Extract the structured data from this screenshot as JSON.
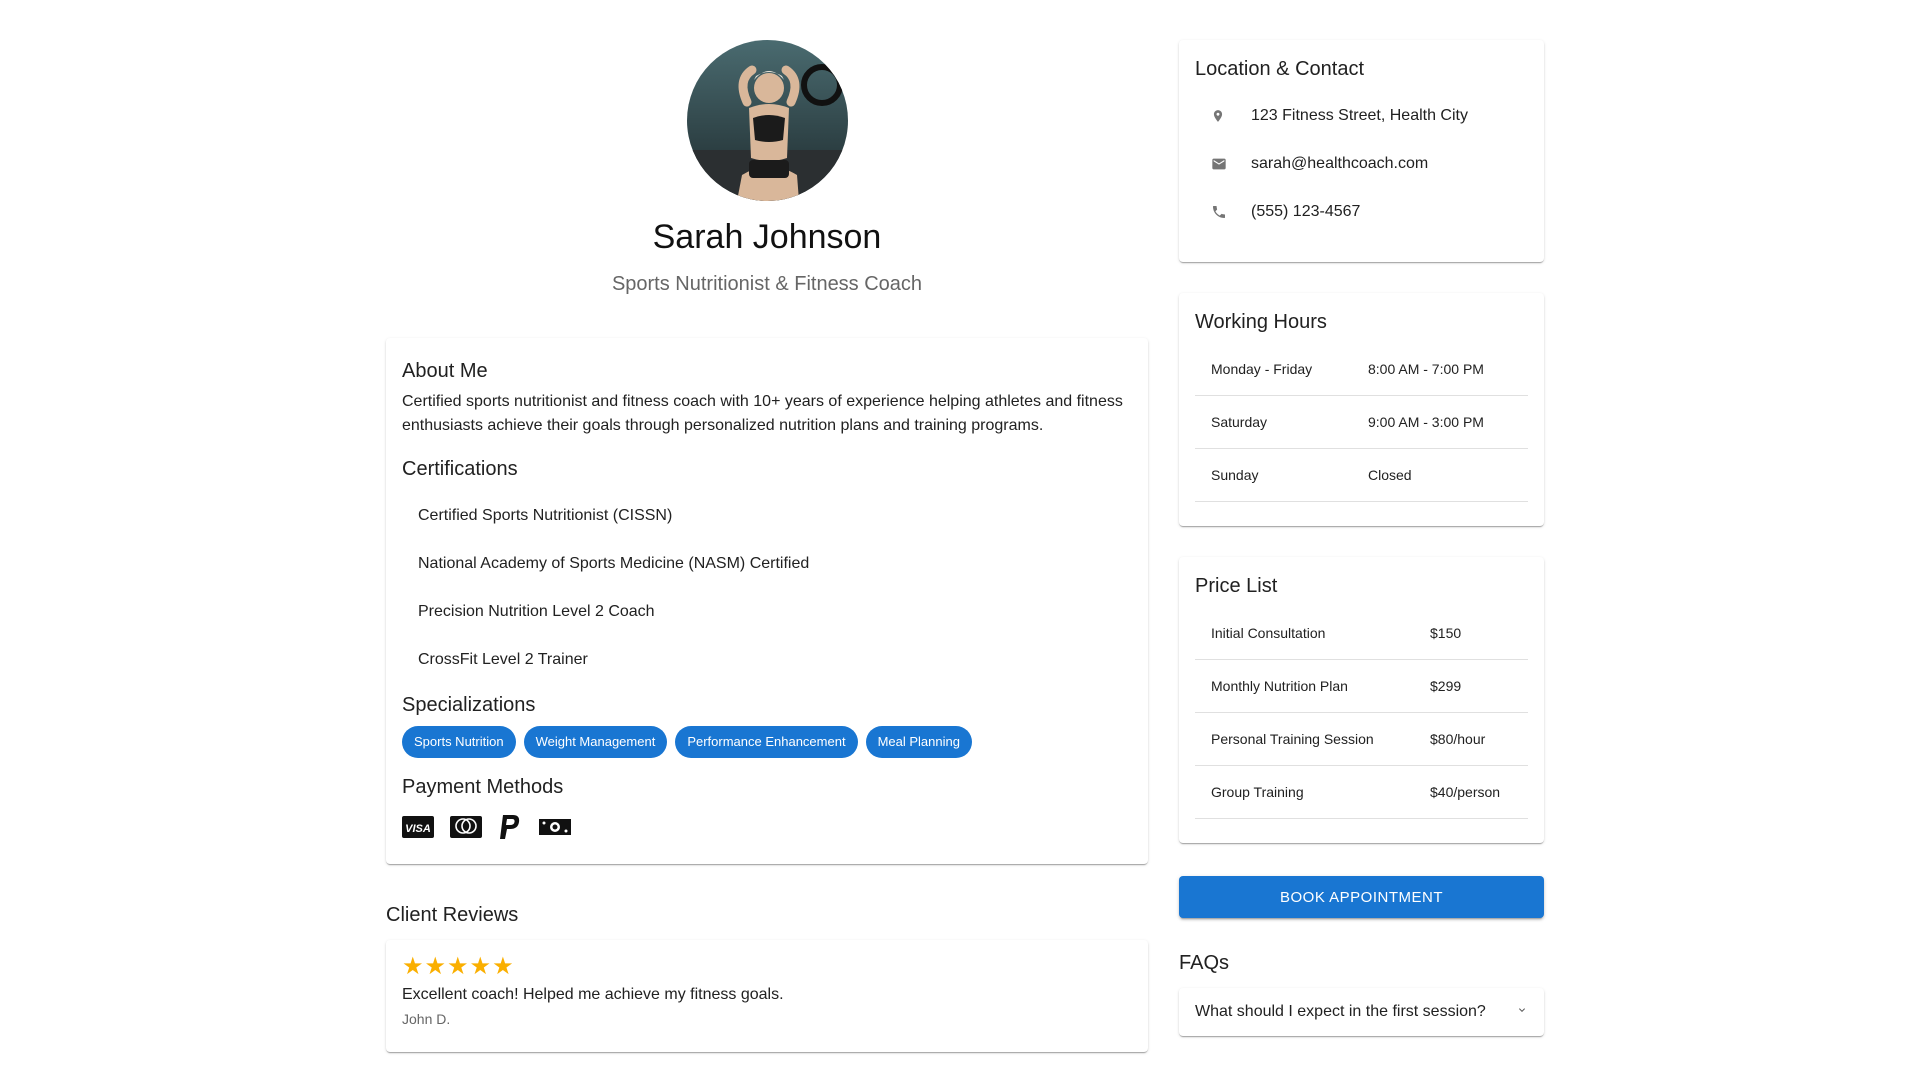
{
  "profile": {
    "name": "Sarah Johnson",
    "title": "Sports Nutritionist & Fitness Coach"
  },
  "about": {
    "heading": "About Me",
    "text": "Certified sports nutritionist and fitness coach with 10+ years of experience helping athletes and fitness enthusiasts achieve their goals through personalized nutrition plans and training programs."
  },
  "certifications": {
    "heading": "Certifications",
    "items": [
      "Certified Sports Nutritionist (CISSN)",
      "National Academy of Sports Medicine (NASM) Certified",
      "Precision Nutrition Level 2 Coach",
      "CrossFit Level 2 Trainer"
    ]
  },
  "specializations": {
    "heading": "Specializations",
    "chips": [
      "Sports Nutrition",
      "Weight Management",
      "Performance Enhancement",
      "Meal Planning"
    ]
  },
  "payment": {
    "heading": "Payment Methods",
    "icons": [
      "visa-icon",
      "mastercard-icon",
      "paypal-icon",
      "cash-icon"
    ],
    "visa_text": "VISA"
  },
  "reviews": {
    "heading": "Client Reviews",
    "items": [
      {
        "rating": 5,
        "text": "Excellent coach! Helped me achieve my fitness goals.",
        "author": "John D."
      }
    ]
  },
  "contact": {
    "heading": "Location & Contact",
    "address": "123 Fitness Street, Health City",
    "email": "sarah@healthcoach.com",
    "phone": "(555) 123-4567"
  },
  "hours": {
    "heading": "Working Hours",
    "rows": [
      {
        "day": "Monday - Friday",
        "time": "8:00 AM - 7:00 PM"
      },
      {
        "day": "Saturday",
        "time": "9:00 AM - 3:00 PM"
      },
      {
        "day": "Sunday",
        "time": "Closed"
      }
    ]
  },
  "prices": {
    "heading": "Price List",
    "rows": [
      {
        "service": "Initial Consultation",
        "price": "$150"
      },
      {
        "service": "Monthly Nutrition Plan",
        "price": "$299"
      },
      {
        "service": "Personal Training Session",
        "price": "$80/hour"
      },
      {
        "service": "Group Training",
        "price": "$40/person"
      }
    ]
  },
  "book_button": "Book Appointment",
  "faqs": {
    "heading": "FAQs",
    "items": [
      "What should I expect in the first session?"
    ]
  },
  "colors": {
    "primary": "#1976d2",
    "star": "#faaf00",
    "secondary_text": "#666666"
  }
}
